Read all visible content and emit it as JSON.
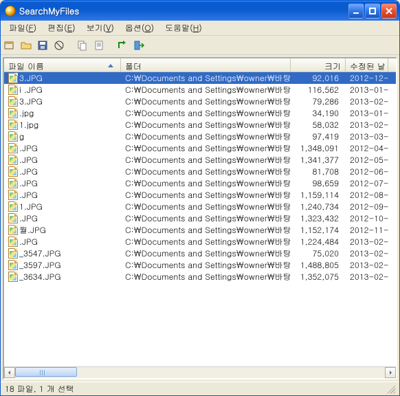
{
  "window": {
    "title": "SearchMyFiles"
  },
  "menu": {
    "file": "파일",
    "file_key": "F",
    "edit": "편집",
    "edit_key": "E",
    "view": "보기",
    "view_key": "V",
    "option": "옵션",
    "option_key": "O",
    "help": "도움말",
    "help_key": "H"
  },
  "columns": {
    "name": "파일 이름",
    "folder": "폴더",
    "size": "크기",
    "modified": "수정된 날"
  },
  "status": "18 파일, 1 개 선택",
  "rows": [
    {
      "name": "3.JPG",
      "folder": "C:\\Documents and Settings\\owner\\바탕 화면\\달력",
      "size": "92,016",
      "mod": "2012-12-",
      "selected": true
    },
    {
      "name": "i .JPG",
      "folder": "C:\\Documents and Settings\\owner\\바탕 화면\\달력",
      "size": "116,562",
      "mod": "2013-01-"
    },
    {
      "name": "3.JPG",
      "folder": "C:\\Documents and Settings\\owner\\바탕 화면\\달력",
      "size": "79,286",
      "mod": "2013-02-"
    },
    {
      "name": ".jpg",
      "folder": "C:\\Documents and Settings\\owner\\바탕 화면\\달력",
      "size": "34,190",
      "mod": "2013-01-"
    },
    {
      "name": "1.jpg",
      "folder": "C:\\Documents and Settings\\owner\\바탕 화면\\달력",
      "size": "58,032",
      "mod": "2013-02-"
    },
    {
      "name": "g",
      "folder": "C:\\Documents and Settings\\owner\\바탕 화면",
      "size": "97,419",
      "mod": "2013-03-"
    },
    {
      "name": ".JPG",
      "folder": "C:\\Documents and Settings\\owner\\바탕 화면\\달력",
      "size": "1,348,091",
      "mod": "2012-04-"
    },
    {
      "name": ".JPG",
      "folder": "C:\\Documents and Settings\\owner\\바탕 화면\\달력",
      "size": "1,341,377",
      "mod": "2012-05-"
    },
    {
      "name": ".JPG",
      "folder": "C:\\Documents and Settings\\owner\\바탕 화면\\달력",
      "size": "81,708",
      "mod": "2012-06-"
    },
    {
      "name": ".JPG",
      "folder": "C:\\Documents and Settings\\owner\\바탕 화면\\달력",
      "size": "98,659",
      "mod": "2012-07-"
    },
    {
      "name": ".JPG",
      "folder": "C:\\Documents and Settings\\owner\\바탕 화면\\달력",
      "size": "1,159,114",
      "mod": "2012-08-"
    },
    {
      "name": "1.JPG",
      "folder": "C:\\Documents and Settings\\owner\\바탕 화면\\달력",
      "size": "1,240,734",
      "mod": "2012-09-"
    },
    {
      "name": ".JPG",
      "folder": "C:\\Documents and Settings\\owner\\바탕 화면\\달력",
      "size": "1,323,432",
      "mod": "2012-10-"
    },
    {
      "name": "월.JPG",
      "folder": "C:\\Documents and Settings\\owner\\바탕 화면\\달력",
      "size": "1,152,174",
      "mod": "2012-11-"
    },
    {
      "name": ".JPG",
      "folder": "C:\\Documents and Settings\\owner\\바탕 화면\\달력",
      "size": "1,224,484",
      "mod": "2013-02-"
    },
    {
      "name": "_3547.JPG",
      "folder": "C:\\Documents and Settings\\owner\\바탕 화면\\달력",
      "size": "75,020",
      "mod": "2013-02-"
    },
    {
      "name": "_3597.JPG",
      "folder": "C:\\Documents and Settings\\owner\\바탕 화면\\달력",
      "size": "1,488,805",
      "mod": "2013-02-"
    },
    {
      "name": "_3634.JPG",
      "folder": "C:\\Documents and Settings\\owner\\바탕 화면\\달력",
      "size": "1,352,075",
      "mod": "2013-02-"
    }
  ]
}
